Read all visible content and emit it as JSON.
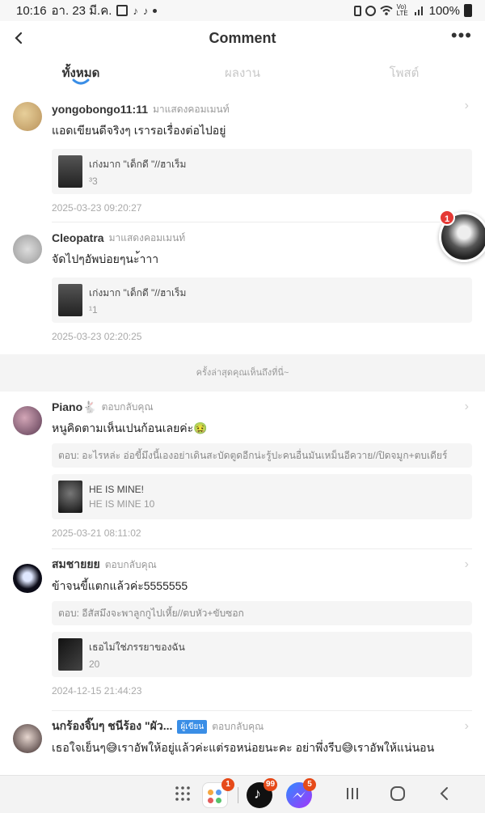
{
  "status_bar": {
    "time": "10:16",
    "date": "อา. 23 มี.ค.",
    "battery": "100%",
    "network": "Vo) LTE"
  },
  "header": {
    "title": "Comment"
  },
  "tabs": [
    {
      "label": "ทั้งหมด",
      "active": true
    },
    {
      "label": "ผลงาน",
      "active": false
    },
    {
      "label": "โพสต์",
      "active": false
    }
  ],
  "comments": [
    {
      "username": "yongobongo11:11",
      "action": "มาแสดงคอมเมนท์",
      "text": "แอดเขียนดีจริงๆ เรารอเรื่องต่อไปอยู่",
      "work_title": "เก่งมาก \"เด็กดี \"//ฮาเร็ม",
      "work_sub": "³3",
      "date": "2025-03-23 09:20:27"
    },
    {
      "username": "Cleopatra",
      "action": "มาแสดงคอมเมนท์",
      "text": "จัดไปๆอัพบ่อยๆนะ้าาา",
      "work_title": "เก่งมาก \"เด็กดี \"//ฮาเร็ม",
      "work_sub": "¹1",
      "date": "2025-03-23 02:20:25"
    }
  ],
  "last_seen_label": "ครั้งล่าสุดคุณเห็นถึงที่นี่~",
  "replies": [
    {
      "username": "Piano🐇",
      "action": "ตอบกลับคุณ",
      "text": "หนูคิดตามเห็นเปนก้อนเลยค่ะ🤢",
      "quote": "ตอบ: อะไรหล่ะ อ่อขี้มึงนี้เองอย่าเดินสะบัดตูดอีกน่ะรู้ปะคนอื่นมันเหม็นอีควาย//ปิดจมูก+ตบเดียร์",
      "work_title": "HE IS MINE!",
      "work_sub": "HE IS MINE 10",
      "date": "2025-03-21 08:11:02"
    },
    {
      "username": "สมชายยย",
      "action": "ตอบกลับคุณ",
      "text": "ข้าจนขี้แตกแล้วค่ะ5555555",
      "quote": "ตอบ: อีสัสมึงจะพาลูกกูไปเหี้ย//ตบหัว+ขับซอก",
      "work_title": "เธอไม่ใช่ภรรยาของฉัน",
      "work_sub": "20",
      "date": "2024-12-15 21:44:23"
    },
    {
      "username": "นกร้องจิ๊บๆ ชนีร้อง \"ผัว...",
      "badge": "ผู้เขียน",
      "action": "ตอบกลับคุณ",
      "text": "เธอใจเย็นๆ😅เราอัพให้อยู่แล้วค่ะแต่รอหน่อยนะคะ อย่าพึ่งรีบ😅เราอัพให้แน่นอน"
    }
  ],
  "floating_badge": "1",
  "nav_badges": {
    "app1": "1",
    "tiktok": "99",
    "messenger": "5"
  },
  "colors": {
    "accent": "#3a8ee6",
    "badge_red": "#e53935"
  }
}
